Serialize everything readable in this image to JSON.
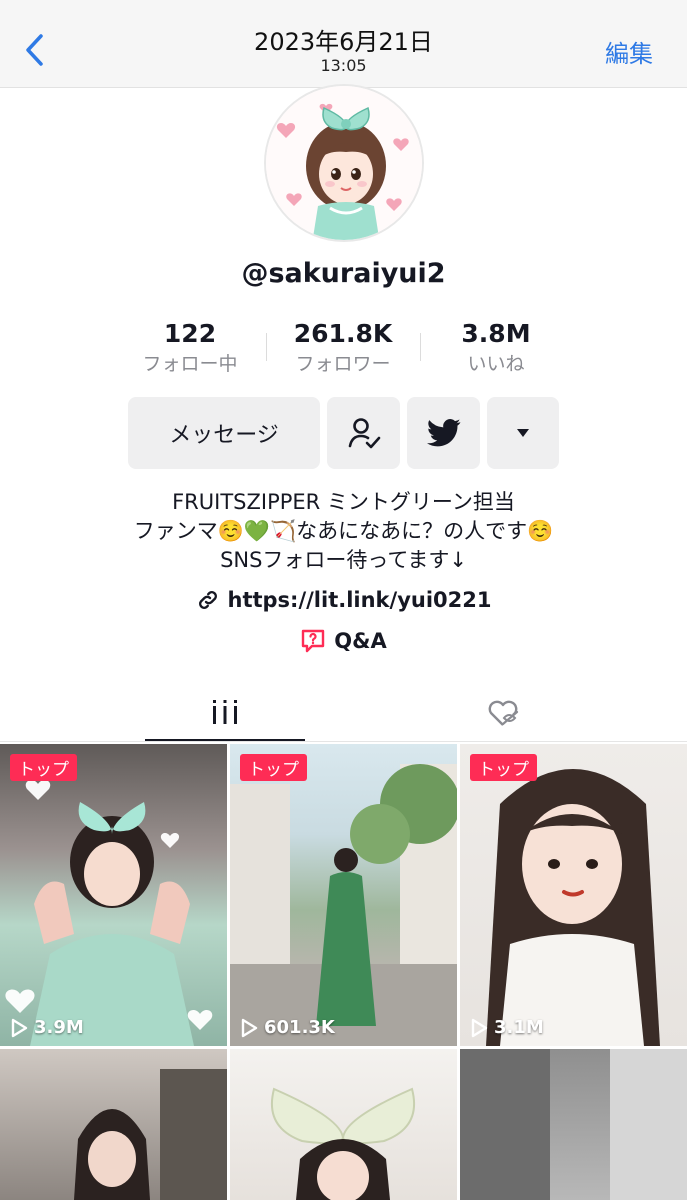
{
  "header": {
    "date": "2023年6月21日",
    "time": "13:05",
    "edit_label": "編集"
  },
  "profile": {
    "username": "@sakuraiyui2",
    "stats": [
      {
        "value": "122",
        "label": "フォロー中"
      },
      {
        "value": "261.8K",
        "label": "フォロワー"
      },
      {
        "value": "3.8M",
        "label": "いいね"
      }
    ],
    "message_label": "メッセージ",
    "bio_lines": [
      "FRUITSZIPPER ミントグリーン担当",
      "ファンマ☺️💚🏹なあになあに？の人です☺️",
      "SNSフォロー待ってます↓"
    ],
    "link": "https://lit.link/yui0221",
    "qa_label": "Q&A"
  },
  "videos": [
    {
      "badge": "トップ",
      "views": "3.9M"
    },
    {
      "badge": "トップ",
      "views": "601.3K"
    },
    {
      "badge": "トップ",
      "views": "3.1M"
    },
    {
      "badge": "",
      "views": ""
    },
    {
      "badge": "",
      "views": ""
    },
    {
      "badge": "",
      "views": ""
    }
  ],
  "colors": {
    "accent_red": "#fe2c55",
    "link_blue": "#2f7ae5",
    "button_bg": "#efeff0"
  }
}
